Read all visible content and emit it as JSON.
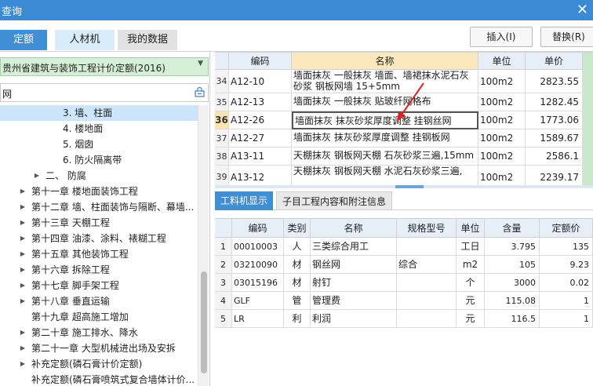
{
  "window": {
    "title": "查询",
    "close_glyph": "✕"
  },
  "toolbar": {
    "tabs": [
      "定额",
      "人材机",
      "我的数据"
    ],
    "insert_label": "插入(I)",
    "replace_label": "替换(R)"
  },
  "left": {
    "quota_library": "贵州省建筑与装饰工程计价定额(2016)",
    "search_value": "网",
    "tree": [
      {
        "label": "3. 墙、柱面",
        "indent": 80,
        "arrow": "",
        "selected": true
      },
      {
        "label": "4. 楼地面",
        "indent": 80,
        "arrow": ""
      },
      {
        "label": "5. 烟囱",
        "indent": 80,
        "arrow": ""
      },
      {
        "label": "6. 防火隔离带",
        "indent": 80,
        "arrow": ""
      },
      {
        "label": "二、 防腐",
        "indent": 58,
        "arrow": "▶"
      },
      {
        "label": "第十一章 楼地面装饰工程",
        "indent": 40,
        "arrow": "▶"
      },
      {
        "label": "第十二章 墙、柱面装饰与隔断、幕墙...",
        "indent": 40,
        "arrow": "▶"
      },
      {
        "label": "第十三章 天棚工程",
        "indent": 40,
        "arrow": "▶"
      },
      {
        "label": "第十四章 油漆、涂料、裱糊工程",
        "indent": 40,
        "arrow": "▶"
      },
      {
        "label": "第十五章 其他装饰工程",
        "indent": 40,
        "arrow": "▶"
      },
      {
        "label": "第十六章 拆除工程",
        "indent": 40,
        "arrow": "▶"
      },
      {
        "label": "第十七章 脚手架工程",
        "indent": 40,
        "arrow": "▶"
      },
      {
        "label": "第十八章 垂直运输",
        "indent": 40,
        "arrow": "▶"
      },
      {
        "label": "第十九章 超高施工增加",
        "indent": 40,
        "arrow": ""
      },
      {
        "label": "第二十章 施工排水、降水",
        "indent": 40,
        "arrow": "▶"
      },
      {
        "label": "第二十一章 大型机械进出场及安拆",
        "indent": 40,
        "arrow": "▶"
      },
      {
        "label": "补充定额(磷石膏计价定额)",
        "indent": 40,
        "arrow": "▶"
      },
      {
        "label": "补充定额(磷石膏喷筑式复合墙体计价...",
        "indent": 40,
        "arrow": ""
      }
    ]
  },
  "quota_table": {
    "headers": [
      "编码",
      "名称",
      "单位",
      "单价"
    ],
    "rows": [
      {
        "no": "34",
        "code": "A12-10",
        "name": "墙面抹灰 一般抹灰 墙面、墙裙抹水泥石灰砂浆 钢板网墙 15+5mm",
        "unit": "100m2",
        "price": "2823.55"
      },
      {
        "no": "35",
        "code": "A12-13",
        "name": "墙面抹灰 一般抹灰 贴玻纤网格布",
        "unit": "100m2",
        "price": "1282.45"
      },
      {
        "no": "36",
        "code": "A12-26",
        "name": "墙面抹灰 抹灰砂浆厚度调整 挂钢丝网",
        "unit": "100m2",
        "price": "1773.06"
      },
      {
        "no": "37",
        "code": "A12-27",
        "name": "墙面抹灰 抹灰砂浆厚度调整 挂钢板网",
        "unit": "100m2",
        "price": "1589.67"
      },
      {
        "no": "38",
        "code": "A13-11",
        "name": "天棚抹灰 钢板网天棚 石灰砂浆三遍,15mm",
        "unit": "100m2",
        "price": "2586.1"
      },
      {
        "no": "39",
        "code": "A13-12",
        "name": "天棚抹灰 钢板网天棚 水泥石灰砂浆三遍,",
        "unit": "100m2",
        "price": "2239.17"
      }
    ]
  },
  "subtabs": [
    "工料机显示",
    "子目工程内容和附注信息"
  ],
  "material_table": {
    "headers": [
      "编码",
      "类别",
      "名称",
      "规格型号",
      "单位",
      "含量",
      "定额价"
    ],
    "rows": [
      {
        "no": "1",
        "code": "00010003",
        "cat": "人",
        "name": "三类综合用工",
        "spec": "",
        "unit": "工日",
        "qty": "3.795",
        "price": "135"
      },
      {
        "no": "2",
        "code": "03210090",
        "cat": "材",
        "name": "钢丝网",
        "spec": "综合",
        "unit": "m2",
        "qty": "105",
        "price": "9.23"
      },
      {
        "no": "3",
        "code": "03015196",
        "cat": "材",
        "name": "射钉",
        "spec": "",
        "unit": "个",
        "qty": "3000",
        "price": "0.02"
      },
      {
        "no": "4",
        "code": "GLF",
        "cat": "管",
        "name": "管理费",
        "spec": "",
        "unit": "元",
        "qty": "115.08",
        "price": "1"
      },
      {
        "no": "5",
        "code": "LR",
        "cat": "利",
        "name": "利润",
        "spec": "",
        "unit": "元",
        "qty": "116.5",
        "price": "1"
      }
    ]
  },
  "icons": {
    "search": "search-icon",
    "close": "close-icon",
    "expand": "triangle-right-icon",
    "combo_arrow": "chevron-down-icon",
    "annotation": "red-arrow"
  },
  "colors": {
    "accent": "#3f8fd6",
    "highlight": "#fbe9bd",
    "library_bg": "#d6efd7",
    "arrow": "#e02020"
  }
}
